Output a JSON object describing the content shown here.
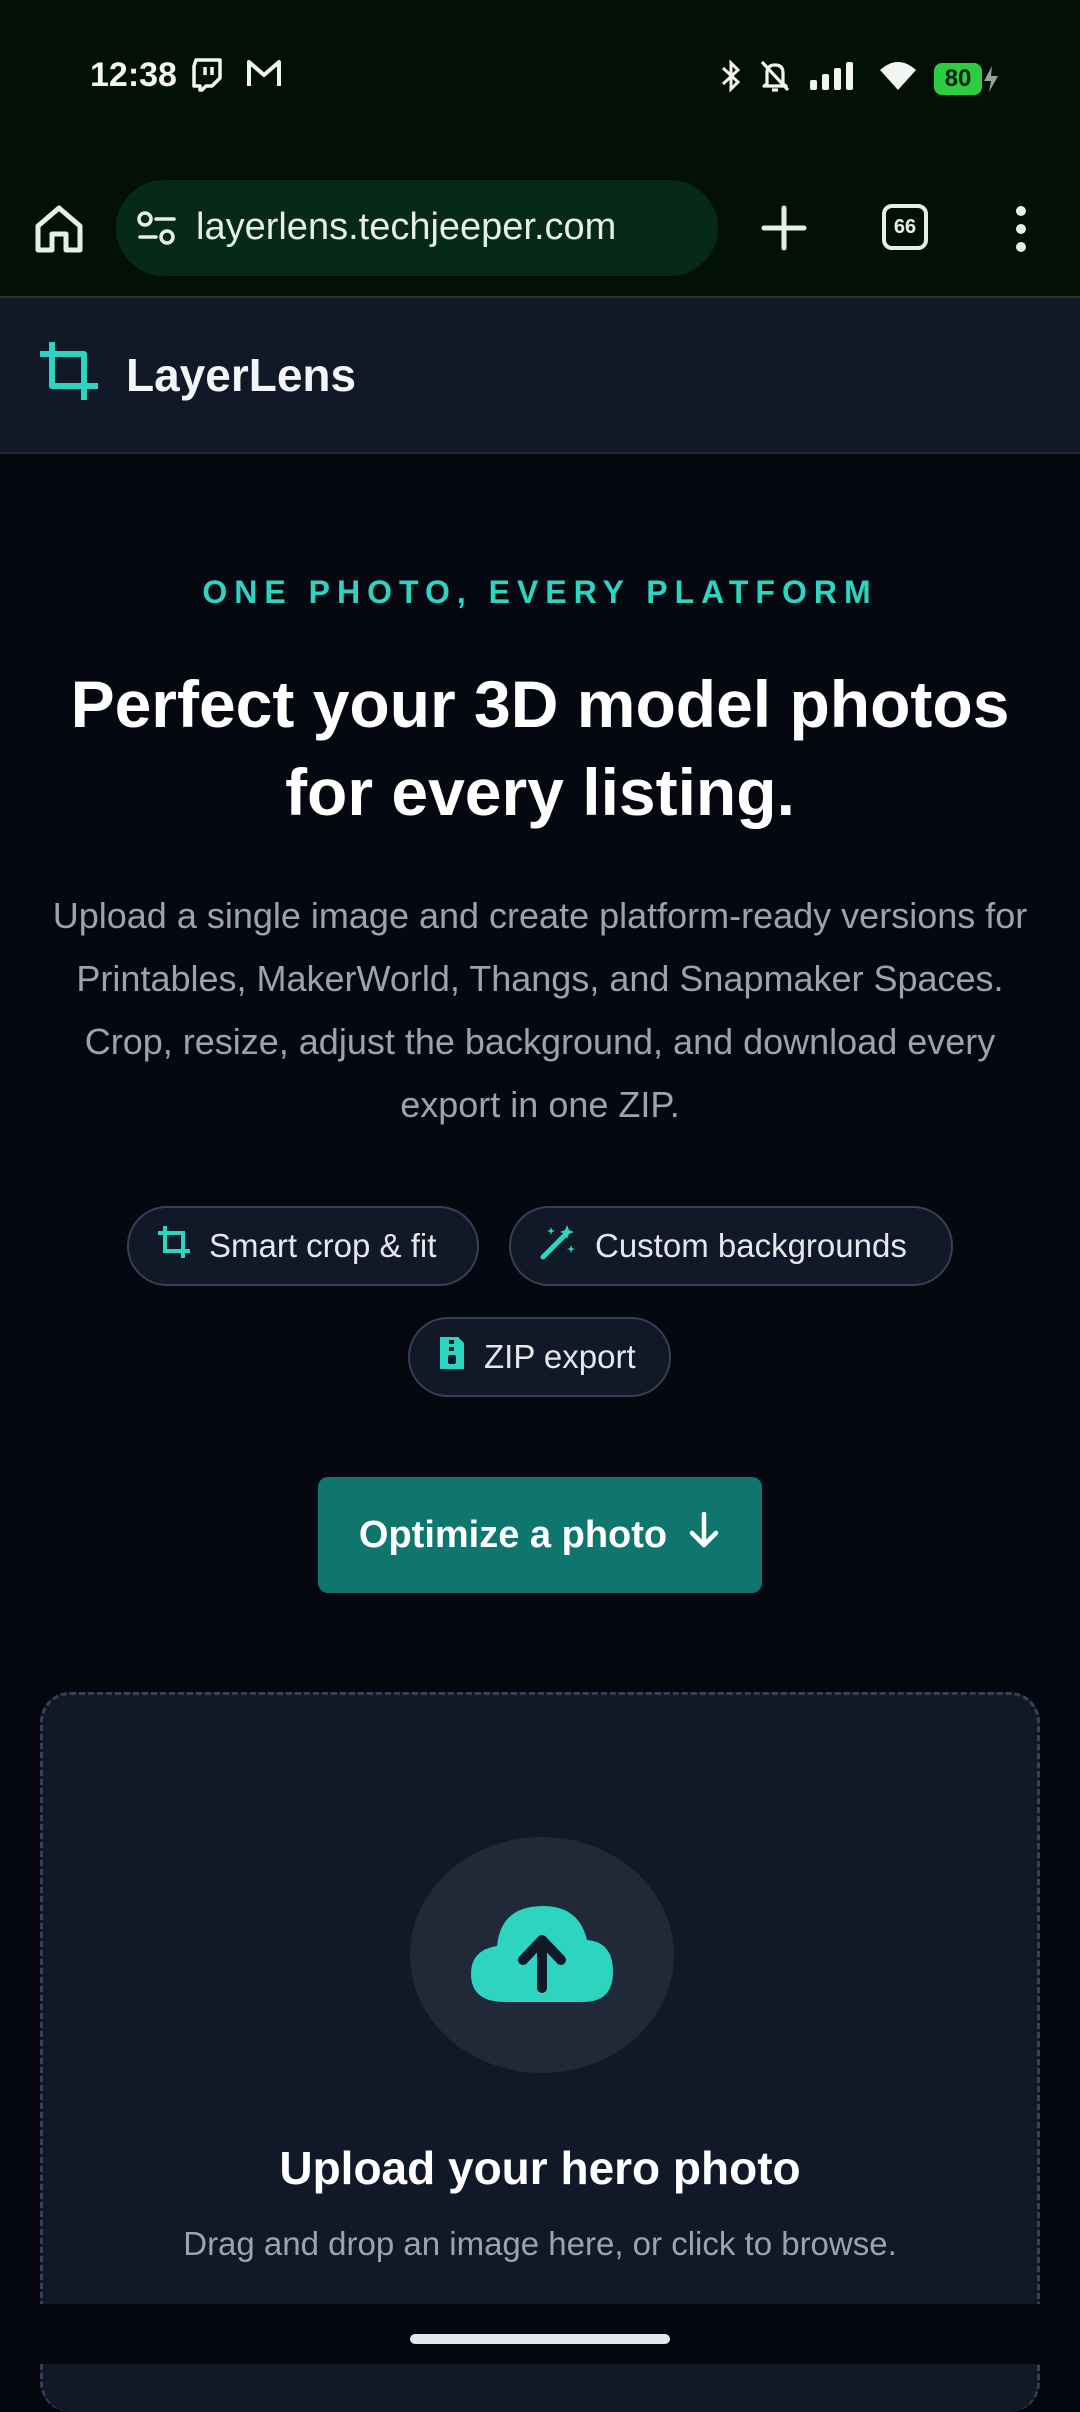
{
  "status_bar": {
    "time": "12:38",
    "battery": "80",
    "left_icons": [
      "twitch-icon",
      "gmail-icon"
    ],
    "right_icons": [
      "bluetooth-icon",
      "mute-icon",
      "signal-icon",
      "wifi-icon",
      "battery-icon"
    ]
  },
  "browser": {
    "url": "layerlens.techjeeper.com",
    "tab_count": "66"
  },
  "site": {
    "brand": "LayerLens"
  },
  "hero": {
    "eyebrow": "ONE PHOTO, EVERY PLATFORM",
    "title_line1": "Perfect your 3D model photos",
    "title_line2": "for every listing.",
    "description": "Upload a single image and create platform-ready versions for Printables, MakerWorld, Thangs, and Snapmaker Spaces. Crop, resize, adjust the background, and download every export in one ZIP."
  },
  "features": [
    {
      "label": "Smart crop & fit",
      "icon": "crop-icon"
    },
    {
      "label": "Custom backgrounds",
      "icon": "magic-wand-icon"
    },
    {
      "label": "ZIP export",
      "icon": "zip-file-icon"
    }
  ],
  "cta": {
    "label": "Optimize a photo",
    "icon": "arrow-down-icon"
  },
  "upload": {
    "title": "Upload your hero photo",
    "hint": "Drag and drop an image here, or click to browse.",
    "icon": "cloud-upload-icon"
  },
  "colors": {
    "accent": "#2dd4bf",
    "cta_bg": "#0f766e",
    "page_bg": "#050810",
    "header_bg": "#111827"
  }
}
